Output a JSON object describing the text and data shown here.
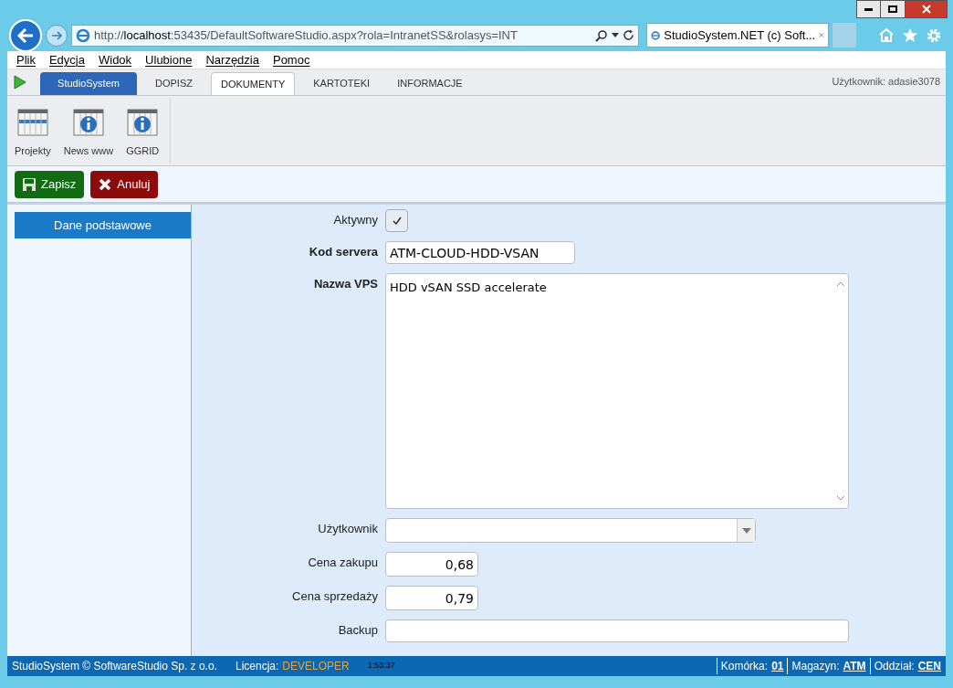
{
  "browser": {
    "url_prefix": "http://",
    "url_host": "localhost",
    "url_rest": ":53435/DefaultSoftwareStudio.aspx?rola=IntranetSS&rolasys=INT",
    "tab_title": "StudioSystem.NET (c) Soft..."
  },
  "menu": [
    "Plik",
    "Edycja",
    "Widok",
    "Ulubione",
    "Narzędzia",
    "Pomoc"
  ],
  "app_tabs": [
    {
      "label": "StudioSystem",
      "selected": false,
      "kind": "brand"
    },
    {
      "label": "DOPISZ",
      "selected": false,
      "kind": "tab"
    },
    {
      "label": "DOKUMENTY",
      "selected": true,
      "kind": "tab"
    },
    {
      "label": "KARTOTEKI",
      "selected": false,
      "kind": "tab"
    },
    {
      "label": "INFORMACJE",
      "selected": false,
      "kind": "tab"
    }
  ],
  "user": "Użytkownik: adasie3078",
  "toolbar": [
    {
      "label": "Projekty",
      "kind": "calendar"
    },
    {
      "label": "News www",
      "kind": "info"
    },
    {
      "label": "GGRID",
      "kind": "info"
    }
  ],
  "actions": [
    {
      "label": "Zapisz",
      "kind": "save"
    },
    {
      "label": "Anuluj",
      "kind": "cancel"
    }
  ],
  "sidebar": [
    {
      "label": "Dane podstawowe",
      "selected": true
    }
  ],
  "form": [
    {
      "label": "Aktywny",
      "kind": "checkbox",
      "required": false,
      "checked": true
    },
    {
      "label": "Kod servera",
      "kind": "text",
      "required": true,
      "value": "ATM-CLOUD-HDD-VSAN"
    },
    {
      "label": "Nazwa VPS",
      "kind": "textarea",
      "required": true,
      "value": "HDD vSAN SSD accelerate"
    },
    {
      "label": "Użytkownik",
      "kind": "select",
      "required": false
    },
    {
      "label": "Cena zakupu",
      "kind": "number",
      "required": false,
      "value": "0,68"
    },
    {
      "label": "Cena sprzedaży",
      "kind": "number",
      "required": false,
      "value": "0,79"
    },
    {
      "label": "Backup",
      "kind": "wide",
      "required": false
    }
  ],
  "status_bar": {
    "copyright": "StudioSystem © SoftwareStudio Sp. z o.o.",
    "license_label": "Licencja:",
    "license": "DEVELOPER",
    "time": "1:53:37",
    "items": [
      {
        "label": "Komórka:",
        "value": "01"
      },
      {
        "label": "Magazyn:",
        "value": "ATM"
      },
      {
        "label": "Oddział:",
        "value": "CEN"
      }
    ]
  }
}
